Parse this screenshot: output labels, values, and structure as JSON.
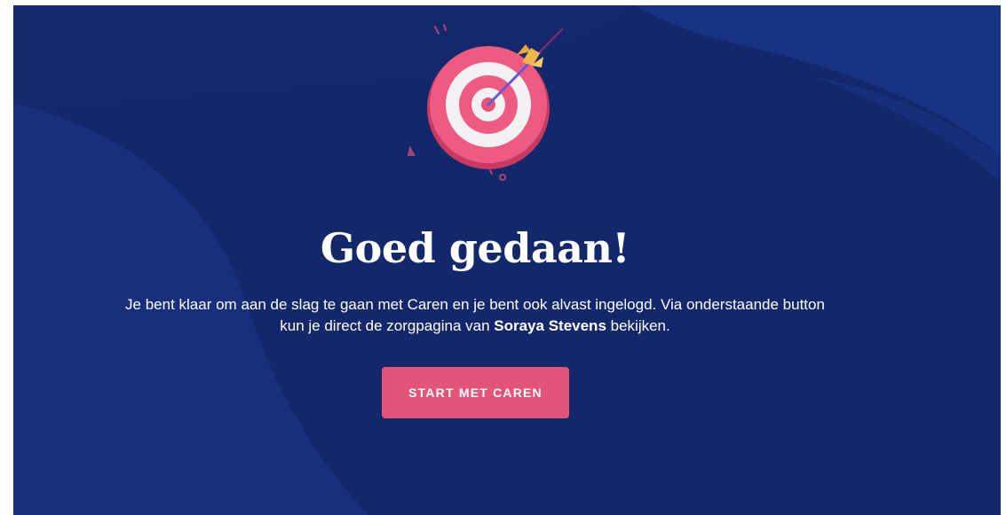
{
  "colors": {
    "background": "#13286a",
    "background_wave_light": "#173180",
    "accent": "#e25478",
    "text": "#ffffff"
  },
  "illustration": {
    "icon": "target-with-arrow-icon"
  },
  "heading": "Goed gedaan!",
  "message": {
    "line1": "Je bent klaar om aan de slag te gaan met Caren en je bent ook alvast ingelogd. Via onderstaande button",
    "line2_before": "kun je direct de zorgpagina van ",
    "name": "Soraya Stevens",
    "line2_after": " bekijken."
  },
  "cta_label": "START MET CAREN"
}
